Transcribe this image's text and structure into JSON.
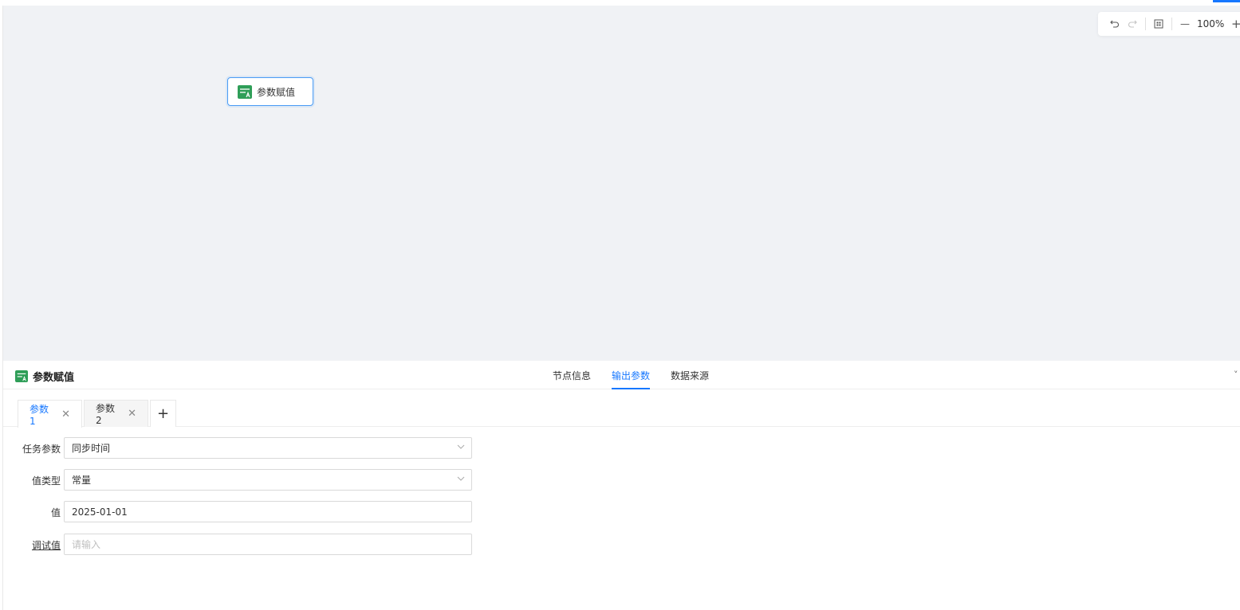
{
  "canvas": {
    "toolbar": {
      "undo_icon": "undo-icon",
      "redo_icon": "redo-icon",
      "fit_icon": "fit-view-icon",
      "zoom_out_label": "—",
      "zoom_level": "100%",
      "zoom_in_label": "+"
    },
    "node": {
      "icon": "param-assign-icon",
      "label": "参数赋值"
    }
  },
  "panel": {
    "title": "参数赋值",
    "tabs": [
      {
        "label": "节点信息",
        "active": false
      },
      {
        "label": "输出参数",
        "active": true
      },
      {
        "label": "数据来源",
        "active": false
      }
    ],
    "collapse_label": "˅",
    "subtabs": [
      {
        "label": "参数1",
        "active": true
      },
      {
        "label": "参数2",
        "active": false
      }
    ],
    "close_glyph": "✕",
    "add_label": "+",
    "form": {
      "task_param": {
        "label": "任务参数",
        "value": "同步时间"
      },
      "value_type": {
        "label": "值类型",
        "value": "常量"
      },
      "value": {
        "label": "值",
        "value": "2025-01-01"
      },
      "debug_value": {
        "label": "调试值",
        "placeholder": "请输入"
      }
    }
  },
  "colors": {
    "accent": "#1677ff",
    "canvas_bg": "#f0f2f5",
    "icon_green": "#2f9e58"
  }
}
